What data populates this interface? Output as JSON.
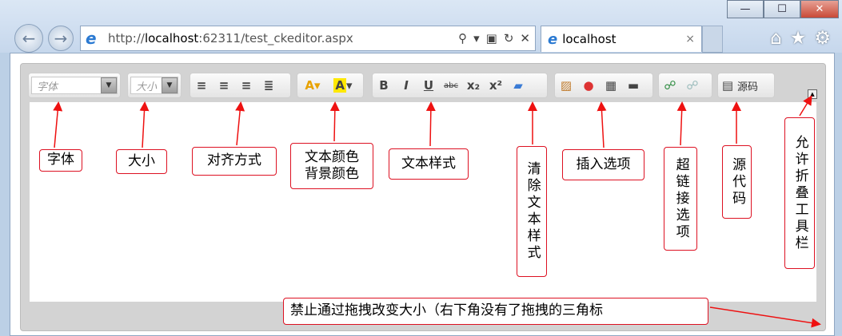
{
  "browser": {
    "window_buttons": [
      "—",
      "☐",
      "✕"
    ],
    "address_prefix": "http://",
    "address_host": "localhost",
    "address_rest": ":62311/test_ckeditor.aspx",
    "tab_title": "localhost",
    "tab_close": "×"
  },
  "toolbar": {
    "font_combo": "字体",
    "size_combo": "大小",
    "source_label": "源码"
  },
  "callouts": {
    "font": "字体",
    "size": "大小",
    "align": "对齐方式",
    "color_line1": "文本颜色",
    "color_line2": "背景颜色",
    "style": "文本样式",
    "clear": "清除文本样式",
    "insert": "插入选项",
    "link": "超链接选项",
    "source": "源代码",
    "collapse": "允许折叠工具栏",
    "resize_note": "禁止通过拖拽改变大小（右下角没有了拖拽的三角标"
  },
  "colors": {
    "accent_red": "#dd1122",
    "chrome": "#c6d7ec",
    "editor_bg": "#d3d3d3"
  }
}
